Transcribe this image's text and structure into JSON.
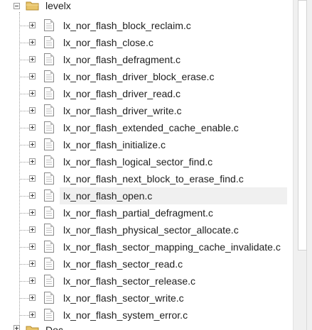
{
  "tree": {
    "parent_folder": {
      "label": "levelx",
      "state": "expanded"
    },
    "files": [
      {
        "label": "lx_nor_flash_block_reclaim.c"
      },
      {
        "label": "lx_nor_flash_close.c"
      },
      {
        "label": "lx_nor_flash_defragment.c"
      },
      {
        "label": "lx_nor_flash_driver_block_erase.c"
      },
      {
        "label": "lx_nor_flash_driver_read.c"
      },
      {
        "label": "lx_nor_flash_driver_write.c"
      },
      {
        "label": "lx_nor_flash_extended_cache_enable.c"
      },
      {
        "label": "lx_nor_flash_initialize.c"
      },
      {
        "label": "lx_nor_flash_logical_sector_find.c"
      },
      {
        "label": "lx_nor_flash_next_block_to_erase_find.c"
      },
      {
        "label": "lx_nor_flash_open.c",
        "selected": true
      },
      {
        "label": "lx_nor_flash_partial_defragment.c"
      },
      {
        "label": "lx_nor_flash_physical_sector_allocate.c"
      },
      {
        "label": "lx_nor_flash_sector_mapping_cache_invalidate.c"
      },
      {
        "label": "lx_nor_flash_sector_read.c"
      },
      {
        "label": "lx_nor_flash_sector_release.c"
      },
      {
        "label": "lx_nor_flash_sector_write.c"
      },
      {
        "label": "lx_nor_flash_system_error.c"
      }
    ],
    "next_folder": {
      "label": "Doc"
    }
  },
  "icons": {
    "folder": "folder-icon",
    "file": "c-source-file-icon",
    "expand": "plus-box-icon",
    "collapse": "minus-box-icon"
  },
  "colors": {
    "selection": "#f0f0f0",
    "text": "#1e1e1e",
    "folder": "#e8c46a",
    "scrollbar_track": "#f0f0f0"
  }
}
